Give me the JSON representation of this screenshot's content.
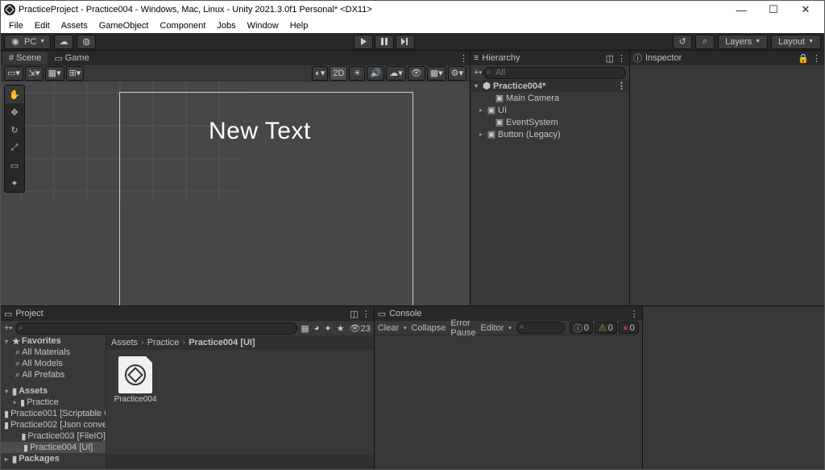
{
  "window": {
    "title": "PracticeProject - Practice004 - Windows, Mac, Linux - Unity 2021.3.0f1 Personal* <DX11>"
  },
  "menubar": [
    "File",
    "Edit",
    "Assets",
    "GameObject",
    "Component",
    "Jobs",
    "Window",
    "Help"
  ],
  "toolbar": {
    "pc_label": "PC",
    "layers": "Layers",
    "layout": "Layout"
  },
  "scene": {
    "tab_scene": "Scene",
    "tab_game": "Game",
    "btn_2d": "2D",
    "canvas_text": "New Text"
  },
  "hierarchy": {
    "title": "Hierarchy",
    "search_ph": "All",
    "items": [
      {
        "type": "scene",
        "label": "Practice004*",
        "indent": 0,
        "folded": "▾"
      },
      {
        "type": "go",
        "label": "Main Camera",
        "indent": 1,
        "folded": ""
      },
      {
        "type": "go",
        "label": "UI",
        "indent": 1,
        "folded": "▸"
      },
      {
        "type": "go",
        "label": "EventSystem",
        "indent": 1,
        "folded": ""
      },
      {
        "type": "go",
        "label": "Button (Legacy)",
        "indent": 1,
        "folded": "▸"
      }
    ]
  },
  "inspector": {
    "title": "Inspector"
  },
  "project": {
    "title": "Project",
    "breadcrumb": [
      "Assets",
      "Practice",
      "Practice004 [UI]"
    ],
    "count_label": "23",
    "asset_label": "Practice004",
    "tree": {
      "fav_header": "Favorites",
      "favs": [
        "All Materials",
        "All Models",
        "All Prefabs"
      ],
      "assets_header": "Assets",
      "practice": "Practice",
      "folders": [
        "Practice001 [Scriptable O",
        "Practice002 [Json conve",
        "Practice003 [FileIO]",
        "Practice004 [UI]"
      ],
      "packages": "Packages"
    }
  },
  "console": {
    "title": "Console",
    "clear": "Clear",
    "collapse": "Collapse",
    "errorpause": "Error Pause",
    "editor": "Editor",
    "counts": {
      "info": "0",
      "warn": "0",
      "err": "0"
    }
  }
}
